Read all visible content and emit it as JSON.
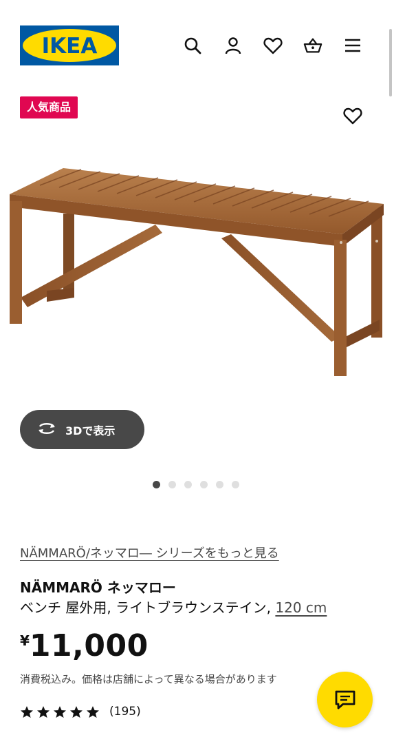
{
  "header": {
    "logo_text": "IKEA",
    "icons": [
      "search-icon",
      "user-icon",
      "heart-icon",
      "basket-icon",
      "menu-icon"
    ]
  },
  "badge": {
    "label": "人気商品"
  },
  "view3d": {
    "label": "3Dで表示",
    "icon": "rotate-3d-icon"
  },
  "carousel": {
    "total": 6,
    "active_index": 0
  },
  "product": {
    "series_link": "NÄMMARÖ/ネッマロ― シリーズをもっと見る",
    "name": "NÄMMARÖ ネッマロー",
    "description": "ベンチ 屋外用, ライトブラウンステイン,",
    "size": "120 cm",
    "currency": "¥",
    "price": "11,000",
    "tax_note": "消費税込み。価格は店舗によって異なる場合があります",
    "rating": 5,
    "review_count": "(195)"
  },
  "chat": {
    "icon": "chat-icon"
  },
  "colors": {
    "ikea_blue": "#0058a3",
    "ikea_yellow": "#ffdb00",
    "badge_red": "#e00751",
    "button_dark": "#484848",
    "text_dark": "#111111"
  }
}
